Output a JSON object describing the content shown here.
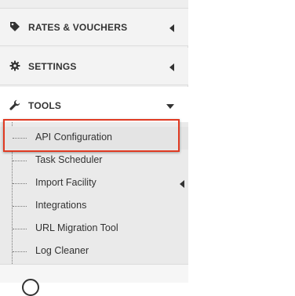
{
  "sidebar": {
    "sections": [
      {
        "label": "RATES & VOUCHERS",
        "icon": "tag-icon",
        "state": "collapsed"
      },
      {
        "label": "SETTINGS",
        "icon": "gear-icon",
        "state": "collapsed"
      },
      {
        "label": "TOOLS",
        "icon": "wrench-icon",
        "state": "expanded"
      }
    ],
    "tools_items": [
      {
        "label": "API Configuration",
        "selected": true
      },
      {
        "label": "Task Scheduler"
      },
      {
        "label": "Import Facility",
        "has_submenu": true
      },
      {
        "label": "Integrations"
      },
      {
        "label": "URL Migration Tool"
      },
      {
        "label": "Log Cleaner"
      }
    ]
  },
  "colors": {
    "highlight": "#e03a22",
    "text": "#333333",
    "sidebar_bg": "#f1f1f1"
  }
}
